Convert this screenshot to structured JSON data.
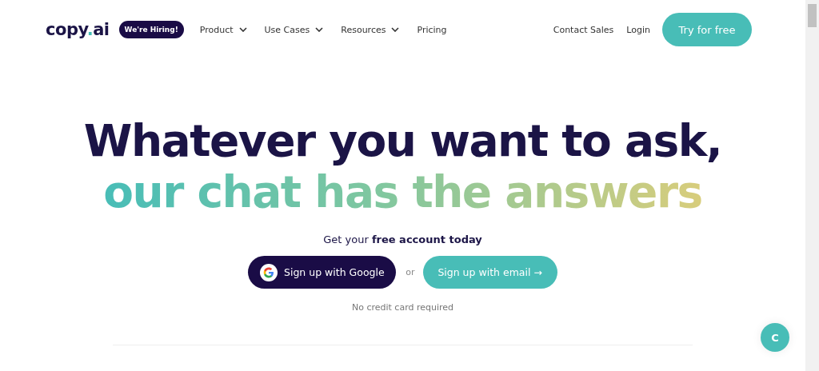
{
  "header": {
    "logo": {
      "text_before": "copy",
      "dot": ".",
      "text_after": "ai"
    },
    "hiring_badge": "We're Hiring!",
    "nav": [
      {
        "label": "Product",
        "dropdown": true
      },
      {
        "label": "Use Cases",
        "dropdown": true
      },
      {
        "label": "Resources",
        "dropdown": true
      },
      {
        "label": "Pricing",
        "dropdown": false
      }
    ],
    "links": [
      "Contact Sales",
      "Login"
    ],
    "cta": "Try for free"
  },
  "hero": {
    "headline": "Whatever you want to ask,",
    "subheadline": "our chat has the answers",
    "prompt": "Get your **free account today**",
    "google_button": "Sign up with Google",
    "separator": "or",
    "email_button": "Sign up with email →",
    "note": "No credit card required"
  },
  "chat_button": "C"
}
